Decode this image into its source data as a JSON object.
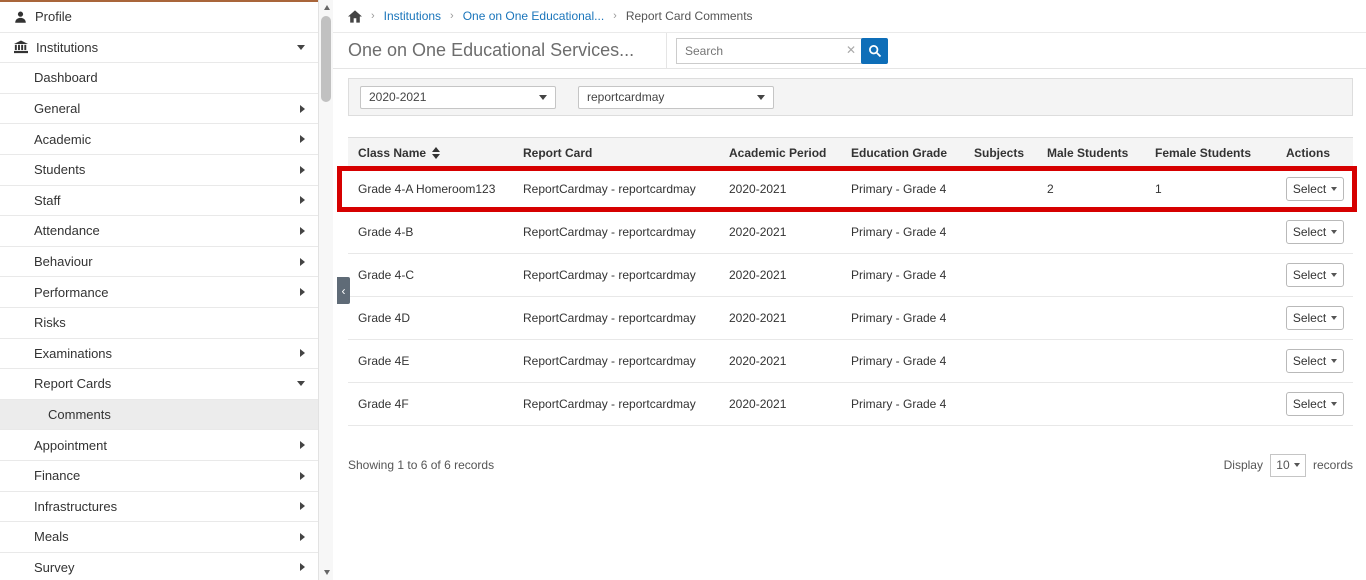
{
  "colors": {
    "link_blue": "#1a75bb",
    "search_button_blue": "#0e6eb8",
    "highlight_red": "#d60000",
    "sidebar_accent_top": "#a9653a"
  },
  "sidebar": {
    "profile_label": "Profile",
    "institutions_label": "Institutions",
    "items": [
      {
        "label": "Dashboard"
      },
      {
        "label": "General"
      },
      {
        "label": "Academic"
      },
      {
        "label": "Students"
      },
      {
        "label": "Staff"
      },
      {
        "label": "Attendance"
      },
      {
        "label": "Behaviour"
      },
      {
        "label": "Performance"
      },
      {
        "label": "Risks"
      },
      {
        "label": "Examinations"
      },
      {
        "label": "Report Cards"
      },
      {
        "label": "Comments"
      },
      {
        "label": "Appointment"
      },
      {
        "label": "Finance"
      },
      {
        "label": "Infrastructures"
      },
      {
        "label": "Meals"
      },
      {
        "label": "Survey"
      }
    ]
  },
  "breadcrumb": {
    "items": [
      {
        "label": "Institutions"
      },
      {
        "label": "One on One Educational..."
      },
      {
        "label": "Report Card Comments"
      }
    ]
  },
  "header": {
    "title": "One on One Educational Services..."
  },
  "search": {
    "placeholder": "Search",
    "clear_glyph": "✕"
  },
  "filters": {
    "academic_year": "2020-2021",
    "report_card": "reportcardmay"
  },
  "table": {
    "columns": [
      {
        "label": "Class Name"
      },
      {
        "label": "Report Card"
      },
      {
        "label": "Academic Period"
      },
      {
        "label": "Education Grade"
      },
      {
        "label": "Subjects"
      },
      {
        "label": "Male Students"
      },
      {
        "label": "Female Students"
      },
      {
        "label": "Actions"
      }
    ],
    "rows": [
      {
        "class_name": "Grade 4-A Homeroom123",
        "report_card": "ReportCardmay - reportcardmay",
        "academic_period": "2020-2021",
        "education_grade": "Primary - Grade 4",
        "subjects": "",
        "male_students": "2",
        "female_students": "1",
        "action": "Select"
      },
      {
        "class_name": "Grade 4-B",
        "report_card": "ReportCardmay - reportcardmay",
        "academic_period": "2020-2021",
        "education_grade": "Primary - Grade 4",
        "subjects": "",
        "male_students": "",
        "female_students": "",
        "action": "Select"
      },
      {
        "class_name": "Grade 4-C",
        "report_card": "ReportCardmay - reportcardmay",
        "academic_period": "2020-2021",
        "education_grade": "Primary - Grade 4",
        "subjects": "",
        "male_students": "",
        "female_students": "",
        "action": "Select"
      },
      {
        "class_name": "Grade 4D",
        "report_card": "ReportCardmay - reportcardmay",
        "academic_period": "2020-2021",
        "education_grade": "Primary - Grade 4",
        "subjects": "",
        "male_students": "",
        "female_students": "",
        "action": "Select"
      },
      {
        "class_name": "Grade 4E",
        "report_card": "ReportCardmay - reportcardmay",
        "academic_period": "2020-2021",
        "education_grade": "Primary - Grade 4",
        "subjects": "",
        "male_students": "",
        "female_students": "",
        "action": "Select"
      },
      {
        "class_name": "Grade 4F",
        "report_card": "ReportCardmay - reportcardmay",
        "academic_period": "2020-2021",
        "education_grade": "Primary - Grade 4",
        "subjects": "",
        "male_students": "",
        "female_students": "",
        "action": "Select"
      }
    ]
  },
  "footer": {
    "showing_text": "Showing 1 to 6 of 6 records",
    "display_label": "Display",
    "page_size": "10",
    "records_label": "records"
  }
}
